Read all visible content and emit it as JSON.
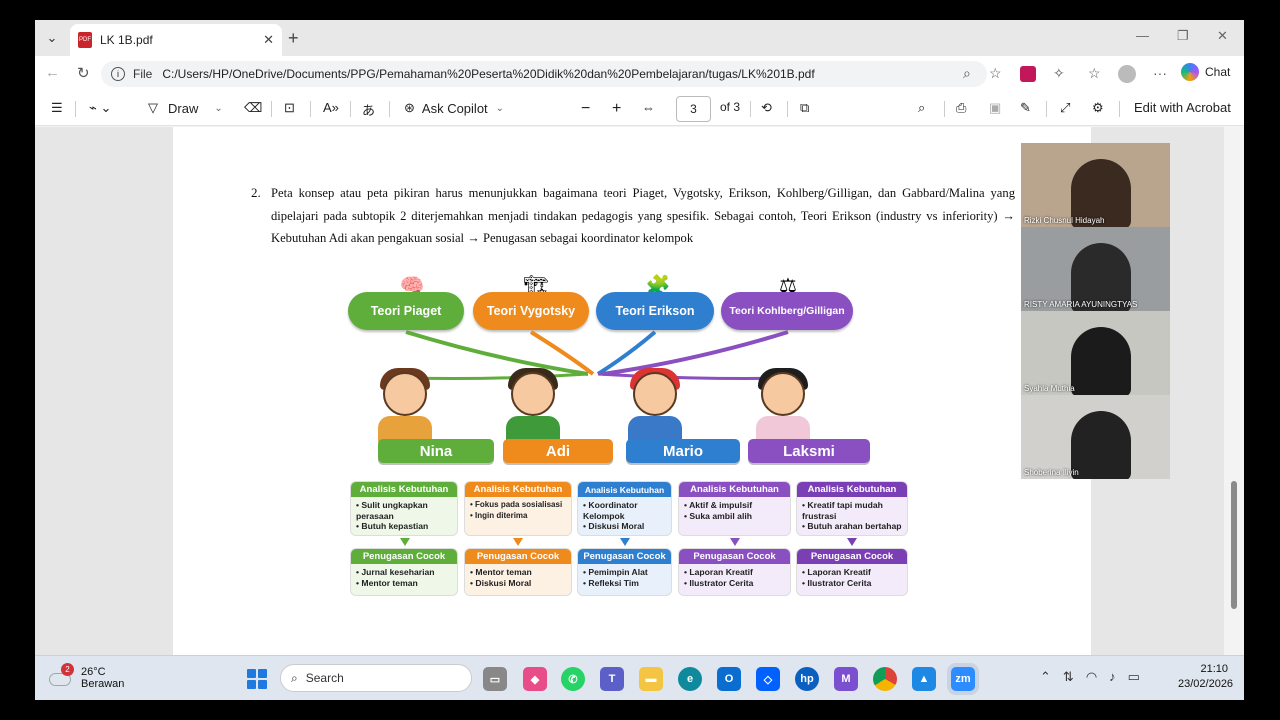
{
  "browser": {
    "tab_title": "LK 1B.pdf",
    "file_label": "File",
    "url": "C:/Users/HP/OneDrive/Documents/PPG/Pemahaman%20Peserta%20Didik%20dan%20Pembelajaran/tugas/LK%201B.pdf",
    "chat_label": "Chat"
  },
  "pdf_toolbar": {
    "draw_label": "Draw",
    "ask_copilot_label": "Ask Copilot",
    "page_number": "3",
    "page_total": "of 3",
    "edit_acrobat_label": "Edit with Acrobat"
  },
  "document": {
    "question_number": "2.",
    "question_text": "Peta konsep atau peta pikiran harus menunjukkan bagaimana teori Piaget, Vygotsky, Erikson, Kohlberg/Gilligan, dan Gabbard/Malina yang dipelajari pada subtopik 2 diterjemahkan menjadi tindakan pedagogis yang spesifik. Sebagai contoh, Teori Erikson (industry vs inferiority) → Kebutuhan Adi akan pengakuan sosial → Penugasan sebagai koordinator kelompok",
    "theories": [
      "Teori Piaget",
      "Teori Vygotsky",
      "Teori Erikson",
      "Teori Kohlberg/Gilligan"
    ],
    "students": [
      "Nina",
      "Adi",
      "Mario",
      "Laksmi"
    ],
    "analysis_header": "Analisis Kebutuhan",
    "task_header": "Penugasan Cocok",
    "cards": [
      {
        "needs": [
          "Sulit ungkapkan perasaan",
          "Butuh kepastian"
        ],
        "tasks": [
          "Jurnal keseharian",
          "Mentor teman"
        ]
      },
      {
        "needs": [
          "Fokus pada sosialisasi",
          "Ingin diterima"
        ],
        "tasks": [
          "Mentor teman",
          "Diskusi Moral"
        ]
      },
      {
        "needs": [
          "Koordinator Kelompok",
          "Diskusi Moral"
        ],
        "tasks": [
          "Pemimpin Alat",
          "Refleksi Tim"
        ]
      },
      {
        "needs": [
          "Aktif & impulsif",
          "Suka ambil alih"
        ],
        "tasks": [
          "Laporan Kreatif",
          "Ilustrator Cerita"
        ]
      },
      {
        "needs": [
          "Kreatif tapi mudah frustrasi",
          "Butuh arahan bertahap"
        ],
        "tasks": [
          "Laporan Kreatif",
          "Ilustrator Cerita"
        ]
      }
    ]
  },
  "participants": [
    "Rizki Chusnul Hidayah",
    "RISTY AMARIA AYUNINGTYAS",
    "Syahla Muthia",
    "Shoberina Iliyin"
  ],
  "taskbar": {
    "weather_temp": "26°C",
    "weather_desc": "Berawan",
    "weather_badge": "2",
    "search_label": "Search",
    "time": "21:10",
    "date": "23/02/2026"
  },
  "colors": {
    "piaget": "#5fae3b",
    "vygotsky": "#ef8a1c",
    "erikson": "#2f7fd0",
    "kohlberg": "#8a4fc1",
    "card_violet": "#7b3fb5"
  }
}
